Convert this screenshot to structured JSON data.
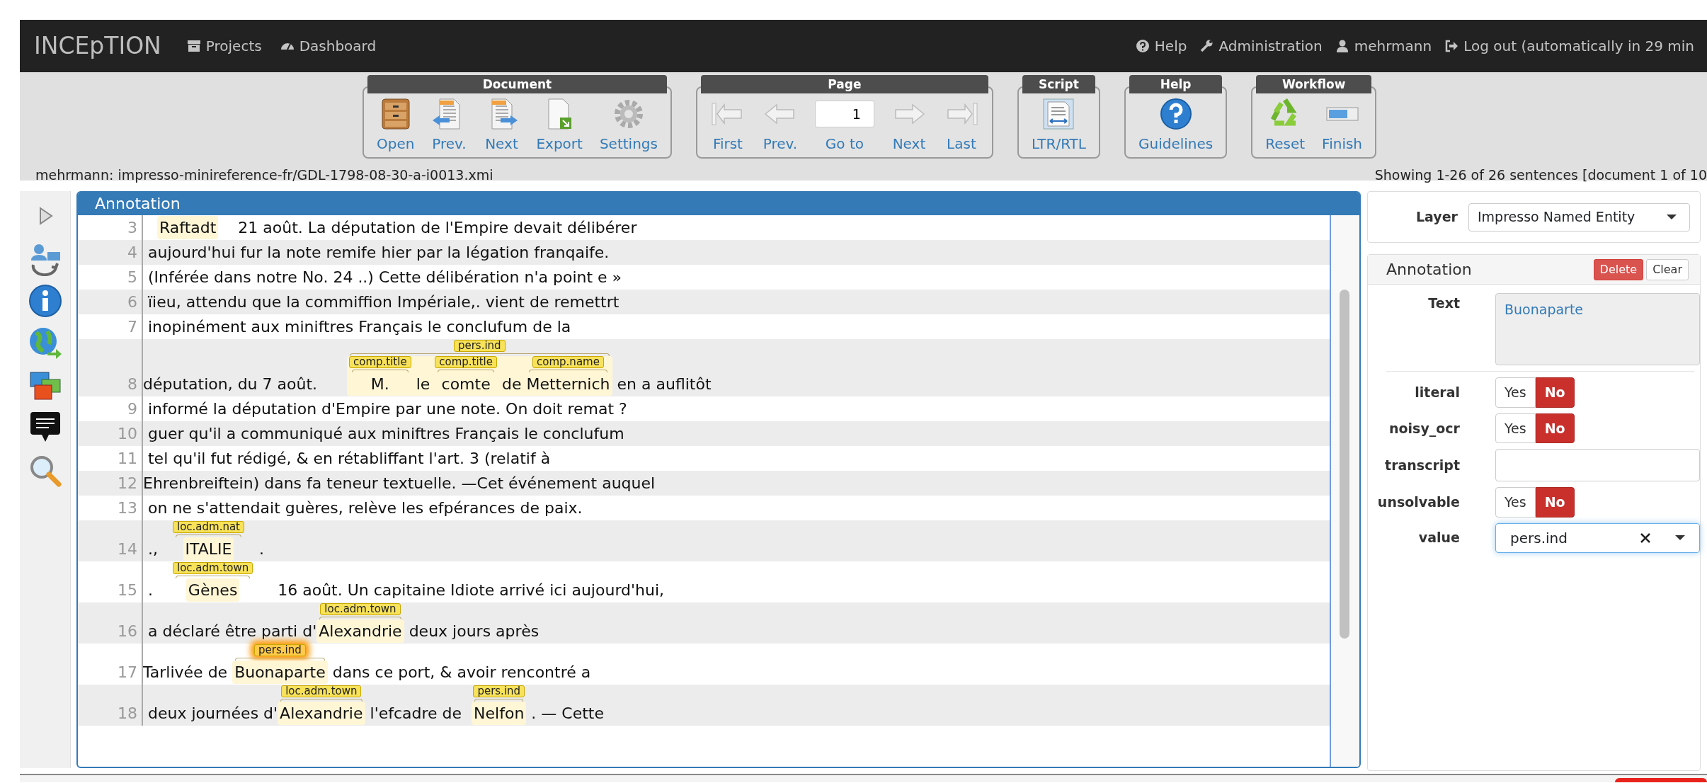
{
  "navbar": {
    "brand": "INCEpTION",
    "left_links": [
      {
        "label": "Projects"
      },
      {
        "label": "Dashboard"
      }
    ],
    "right_links": [
      {
        "label": "Help"
      },
      {
        "label": "Administration"
      },
      {
        "label": "mehrmann"
      },
      {
        "label": "Log out (automatically in 29 min"
      }
    ]
  },
  "toolbar": {
    "groups": [
      {
        "title": "Document",
        "items": [
          {
            "kind": "button",
            "label": "Open"
          },
          {
            "kind": "button",
            "label": "Prev."
          },
          {
            "kind": "button",
            "label": "Next"
          },
          {
            "kind": "button",
            "label": "Export"
          },
          {
            "kind": "button",
            "label": "Settings"
          }
        ]
      },
      {
        "title": "Page",
        "items": [
          {
            "kind": "button",
            "label": "First"
          },
          {
            "kind": "button",
            "label": "Prev."
          },
          {
            "kind": "page-input",
            "label": "Go to",
            "value": "1"
          },
          {
            "kind": "button",
            "label": "Next"
          },
          {
            "kind": "button",
            "label": "Last"
          }
        ]
      },
      {
        "title": "Script",
        "items": [
          {
            "kind": "button",
            "label": "LTR/RTL"
          }
        ]
      },
      {
        "title": "Help",
        "items": [
          {
            "kind": "button",
            "label": "Guidelines"
          }
        ]
      },
      {
        "title": "Workflow",
        "items": [
          {
            "kind": "button",
            "label": "Reset"
          },
          {
            "kind": "button",
            "label": "Finish"
          }
        ]
      }
    ]
  },
  "status": {
    "document_path": "mehrmann: impresso-minireference-fr/GDL-1798-08-30-a-i0013.xmi",
    "sentence_info": "Showing 1-26 of 26 sentences [document 1 of 10"
  },
  "annotation_panel": {
    "title": "Annotation",
    "rows": [
      {
        "number": "3",
        "segments": [
          {
            "kind": "span",
            "text": "Raftadt"
          },
          {
            "kind": "plain",
            "text": "    21 août. La députation de l'Empire devait délibérer"
          }
        ]
      },
      {
        "number": "4",
        "segments": [
          {
            "kind": "plain",
            "text": " aujourd'hui fur la note remife hier par la légation franqaife."
          }
        ]
      },
      {
        "number": "5",
        "segments": [
          {
            "kind": "plain",
            "text": " (Inférée dans notre No. 24 ..) Cette délibération n'a point e »"
          }
        ]
      },
      {
        "number": "6",
        "segments": [
          {
            "kind": "plain",
            "text": " ïieu, attendu que la commiffion Impériale,. vient de remettrt"
          }
        ]
      },
      {
        "number": "7",
        "segments": [
          {
            "kind": "plain",
            "text": " inopinément aux miniftres Français le conclufum de la"
          }
        ]
      },
      {
        "number": "8",
        "segments": [
          {
            "kind": "plain",
            "text": "députation, du 7 août.      "
          },
          {
            "kind": "group",
            "label": "pers.ind",
            "selected": false,
            "parts": [
              {
                "kind": "span",
                "text": "M.",
                "label": "comp.title",
                "selected": false
              },
              {
                "kind": "plain",
                "text": " le "
              },
              {
                "kind": "span",
                "text": "comte",
                "label": "comp.title",
                "selected": false
              },
              {
                "kind": "plain",
                "text": " de "
              },
              {
                "kind": "span",
                "text": "Metternich",
                "label": "comp.name",
                "selected": false
              }
            ]
          },
          {
            "kind": "plain",
            "text": " en a auflitôt"
          }
        ]
      },
      {
        "number": "9",
        "segments": [
          {
            "kind": "plain",
            "text": " informé la députation d'Empire par une note. On doit remat ?"
          }
        ]
      },
      {
        "number": "10",
        "segments": [
          {
            "kind": "plain",
            "text": " guer qu'il a communiqué aux miniftres Français le conclufum"
          }
        ]
      },
      {
        "number": "11",
        "segments": [
          {
            "kind": "plain",
            "text": " tel qu'il fut rédigé, & en rétabliffant l'art. 3 (relatif à"
          }
        ]
      },
      {
        "number": "12",
        "segments": [
          {
            "kind": "plain",
            "text": "Ehrenbreiftein) dans fa teneur textuelle. —Cet événement auquel"
          }
        ]
      },
      {
        "number": "13",
        "segments": [
          {
            "kind": "plain",
            "text": " on ne s'attendait guères, relève les efpérances de paix."
          }
        ]
      },
      {
        "number": "14",
        "segments": [
          {
            "kind": "plain",
            "text": " .,   "
          },
          {
            "kind": "span",
            "text": "ITALIE",
            "label": "loc.adm.nat",
            "selected": false
          },
          {
            "kind": "plain",
            "text": "   ."
          }
        ]
      },
      {
        "number": "15",
        "segments": [
          {
            "kind": "plain",
            "text": " .    "
          },
          {
            "kind": "span",
            "text": "Gènes",
            "label": "loc.adm.town",
            "selected": false
          },
          {
            "kind": "plain",
            "text": "     16 août. Un capitaine Idiote arrivé ici aujourd'hui,"
          }
        ]
      },
      {
        "number": "16",
        "segments": [
          {
            "kind": "plain",
            "text": " a déclaré être parti d'"
          },
          {
            "kind": "span",
            "text": "Alexandrie",
            "label": "loc.adm.town",
            "selected": false
          },
          {
            "kind": "plain",
            "text": " deux jours après"
          }
        ]
      },
      {
        "number": "17",
        "segments": [
          {
            "kind": "plain",
            "text": "Tarlivée de "
          },
          {
            "kind": "span",
            "text": "Buonaparte",
            "label": "pers.ind",
            "selected": true
          },
          {
            "kind": "plain",
            "text": " dans ce port, & avoir rencontré a"
          }
        ]
      },
      {
        "number": "18",
        "segments": [
          {
            "kind": "plain",
            "text": " deux journées d'"
          },
          {
            "kind": "span",
            "text": "Alexandrie",
            "label": "loc.adm.town",
            "selected": false
          },
          {
            "kind": "plain",
            "text": " l'efcadre de  "
          },
          {
            "kind": "span",
            "text": "Nelfon",
            "label": "pers.ind",
            "selected": false
          },
          {
            "kind": "plain",
            "text": " . — Cette"
          }
        ]
      }
    ]
  },
  "layer": {
    "label": "Layer",
    "value": "Impresso Named Entity"
  },
  "annotation_detail": {
    "title": "Annotation",
    "buttons": [
      {
        "kind": "danger",
        "label": "Delete"
      },
      {
        "kind": "default",
        "label": "Clear"
      }
    ],
    "text_label": "Text",
    "text_value": "Buonaparte",
    "features": [
      {
        "kind": "boolean",
        "label": "literal",
        "options": [
          {
            "label": "Yes",
            "selected": false
          },
          {
            "label": "No",
            "selected": true
          }
        ]
      },
      {
        "kind": "boolean",
        "label": "noisy_ocr",
        "options": [
          {
            "label": "Yes",
            "selected": false
          },
          {
            "label": "No",
            "selected": true
          }
        ]
      },
      {
        "kind": "text",
        "label": "transcript"
      },
      {
        "kind": "boolean",
        "label": "unsolvable",
        "options": [
          {
            "label": "Yes",
            "selected": false
          },
          {
            "label": "No",
            "selected": true
          }
        ]
      },
      {
        "kind": "combo",
        "label": "value",
        "value": "pers.ind"
      }
    ]
  }
}
